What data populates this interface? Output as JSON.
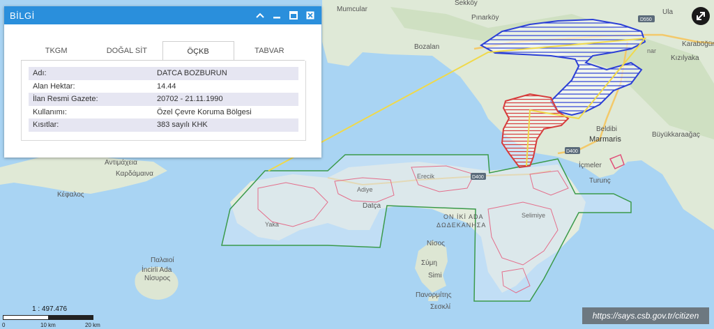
{
  "panel": {
    "title": "BİLGİ",
    "tabs": [
      "TKGM",
      "DOĞAL SİT",
      "ÖÇKB",
      "TABVAR"
    ],
    "active_tab": "ÖÇKB",
    "rows": [
      {
        "label": "Adı:",
        "value": "DATCA BOZBURUN"
      },
      {
        "label": "Alan Hektar:",
        "value": "14.44"
      },
      {
        "label": "İlan Resmi Gazete:",
        "value": "20702 - 21.11.1990"
      },
      {
        "label": "Kullanımı:",
        "value": "Özel Çevre Koruma Bölgesi"
      },
      {
        "label": "Kısıtlar:",
        "value": "383 sayılı KHK"
      }
    ]
  },
  "map": {
    "labels": {
      "mumcular": "Mumcular",
      "sekkoy": "Sekköy",
      "pinarkoy": "Pınarköy",
      "bozalan": "Bozalan",
      "ula": "Ula",
      "karabogurtlen": "Karaböğürtlen",
      "kizilyaka": "Kızılyaka",
      "beldibi": "Beldibi",
      "marmaris": "Marmaris",
      "buyukkaraagac": "Büyükkaraağaç",
      "icmeler": "İçmeler",
      "turunc": "Turunç",
      "datca": "Datça",
      "antimacheia": "Αντιμάχεια",
      "kardamaina": "Καρδάμαινα",
      "kefalos": "Κέφαλος",
      "oniki": "ON İKİ ADA",
      "dodekanisa": "ΔΩΔΕΚΑΝΗΣΑ",
      "nisos": "Νίσος",
      "symi_gr": "Σύμη",
      "simi": "Simi",
      "panormitis": "Πανορμίτης",
      "seskli": "Σεσκλί",
      "palaioi": "Παλαιοί",
      "incirli": "İncirli Ada",
      "nisyros": "Νίσυρος",
      "yaka": "Yaka",
      "adiye": "Adiye",
      "erecik": "Erecik",
      "selimiye": "Selimiye",
      "nar": "nar"
    },
    "road_shields": [
      "D550",
      "D400",
      "D400"
    ]
  },
  "scale": {
    "ratio": "1 : 497.476",
    "t0": "0",
    "t1": "10 km",
    "t2": "20 km"
  },
  "attribution": "https://says.csb.gov.tr/citizen",
  "icons": {
    "minimize": "chevron-up-icon",
    "close": "close-icon",
    "expand": "expand-arrows-icon"
  }
}
